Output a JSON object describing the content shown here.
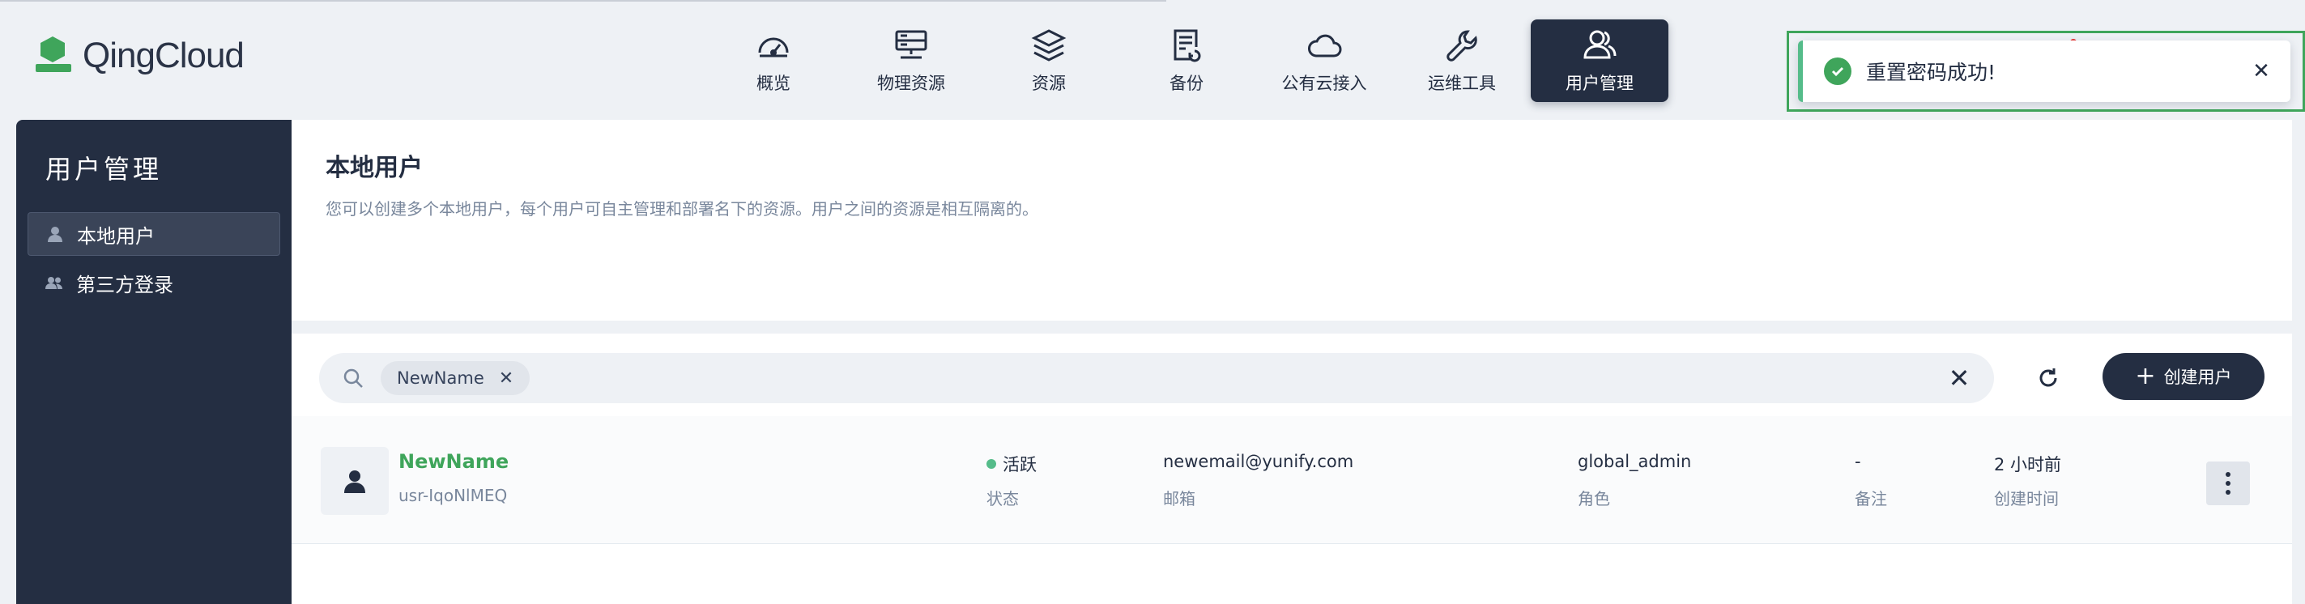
{
  "app": {
    "logo_text": "QingCloud"
  },
  "nav": {
    "items": [
      {
        "label": "概览",
        "icon": "dashboard-gauge-icon"
      },
      {
        "label": "物理资源",
        "icon": "server-icon"
      },
      {
        "label": "资源",
        "icon": "layers-icon"
      },
      {
        "label": "备份",
        "icon": "backup-document-icon"
      },
      {
        "label": "公有云接入",
        "icon": "cloud-icon"
      },
      {
        "label": "运维工具",
        "icon": "wrench-icon"
      },
      {
        "label": "用户管理",
        "icon": "users-icon",
        "active": true
      }
    ]
  },
  "toast": {
    "message": "重置密码成功!",
    "close": "✕"
  },
  "sidebar": {
    "title": "用户管理",
    "items": [
      {
        "label": "本地用户",
        "icon": "user-icon",
        "active": true
      },
      {
        "label": "第三方登录",
        "icon": "users-group-icon"
      }
    ]
  },
  "page": {
    "title": "本地用户",
    "description": "您可以创建多个本地用户，每个用户可自主管理和部署名下的资源。用户之间的资源是相互隔离的。"
  },
  "toolbar": {
    "filter_tag": "NewName",
    "filter_tag_remove": "✕",
    "clear": "✕",
    "create_button": "创建用户",
    "create_plus": "+"
  },
  "users": [
    {
      "name": "NewName",
      "id": "usr-IqoNlMEQ",
      "status": "活跃",
      "status_label": "状态",
      "email": "newemail@yunify.com",
      "email_label": "邮箱",
      "role": "global_admin",
      "role_label": "角色",
      "note": "-",
      "note_label": "备注",
      "created": "2 小时前",
      "created_label": "创建时间"
    }
  ],
  "colors": {
    "brand_green": "#3fa55b",
    "dark_navy": "#242e42",
    "status_active": "#55bc8a"
  }
}
